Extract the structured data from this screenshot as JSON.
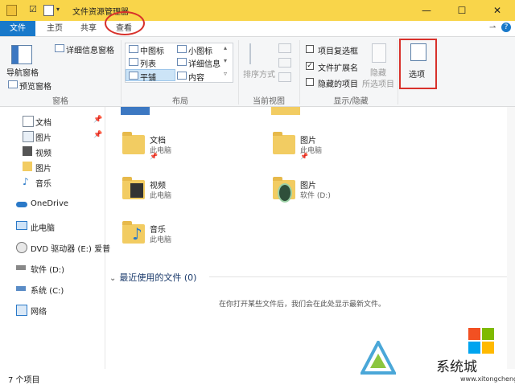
{
  "window": {
    "title": "文件资源管理器",
    "controls": {
      "minimize": "—",
      "maximize": "☐",
      "close": "✕"
    }
  },
  "tabs": [
    {
      "label": "文件"
    },
    {
      "label": "主页"
    },
    {
      "label": "共享"
    },
    {
      "label": "查看"
    }
  ],
  "ribbon": {
    "panes": {
      "nav_pane": "导航窗格",
      "details_pane": "详细信息窗格",
      "preview_pane": "预览窗格",
      "group_label": "窗格"
    },
    "layout": {
      "items": [
        "中图标",
        "小图标",
        "列表",
        "详细信息",
        "平铺",
        "内容"
      ],
      "selected": "平铺",
      "group_label": "布局"
    },
    "current_view": {
      "sort_by": "排序方式",
      "group_label": "当前视图"
    },
    "show_hide": {
      "item_checkboxes": "项目复选框",
      "item_checkboxes_checked": false,
      "file_extensions": "文件扩展名",
      "file_extensions_checked": true,
      "hidden_items": "隐藏的项目",
      "hidden_items_checked": false,
      "hide": "隐藏",
      "hide_selected": "所选项目",
      "group_label": "显示/隐藏"
    },
    "options": {
      "label": "选项"
    }
  },
  "nav": {
    "items": [
      {
        "label": "文档",
        "pinned": true
      },
      {
        "label": "图片",
        "pinned": true
      },
      {
        "label": "视频",
        "pinned": false
      },
      {
        "label": "图片",
        "pinned": false
      },
      {
        "label": "音乐",
        "pinned": false
      },
      {
        "label": "OneDrive",
        "pinned": false
      },
      {
        "label": "此电脑",
        "pinned": false
      },
      {
        "label": "DVD 驱动器 (E:) 爱普",
        "pinned": false
      },
      {
        "label": "软件 (D:)",
        "pinned": false
      },
      {
        "label": "系统 (C:)",
        "pinned": false
      },
      {
        "label": "网络",
        "pinned": false
      }
    ],
    "pin_glyph": "📌"
  },
  "content": {
    "tiles": [
      {
        "name": "文档",
        "location": "此电脑",
        "pinned": true
      },
      {
        "name": "图片",
        "location": "此电脑",
        "pinned": true
      },
      {
        "name": "视频",
        "location": "此电脑",
        "pinned": false
      },
      {
        "name": "图片",
        "location": "软件 (D:)",
        "pinned": false
      },
      {
        "name": "音乐",
        "location": "此电脑",
        "pinned": false
      }
    ],
    "recent": {
      "header": "最近使用的文件 (0)",
      "empty_message": "在你打开某些文件后，我们会在此处显示最新文件。"
    }
  },
  "status": {
    "item_count": "7 个项目"
  },
  "watermark": {
    "text": "系统城",
    "url": "www.xitongcheng.com"
  },
  "colors": {
    "title_bar": "#f9d54a",
    "file_tab": "#1979ca",
    "highlight": "#d8312b"
  }
}
